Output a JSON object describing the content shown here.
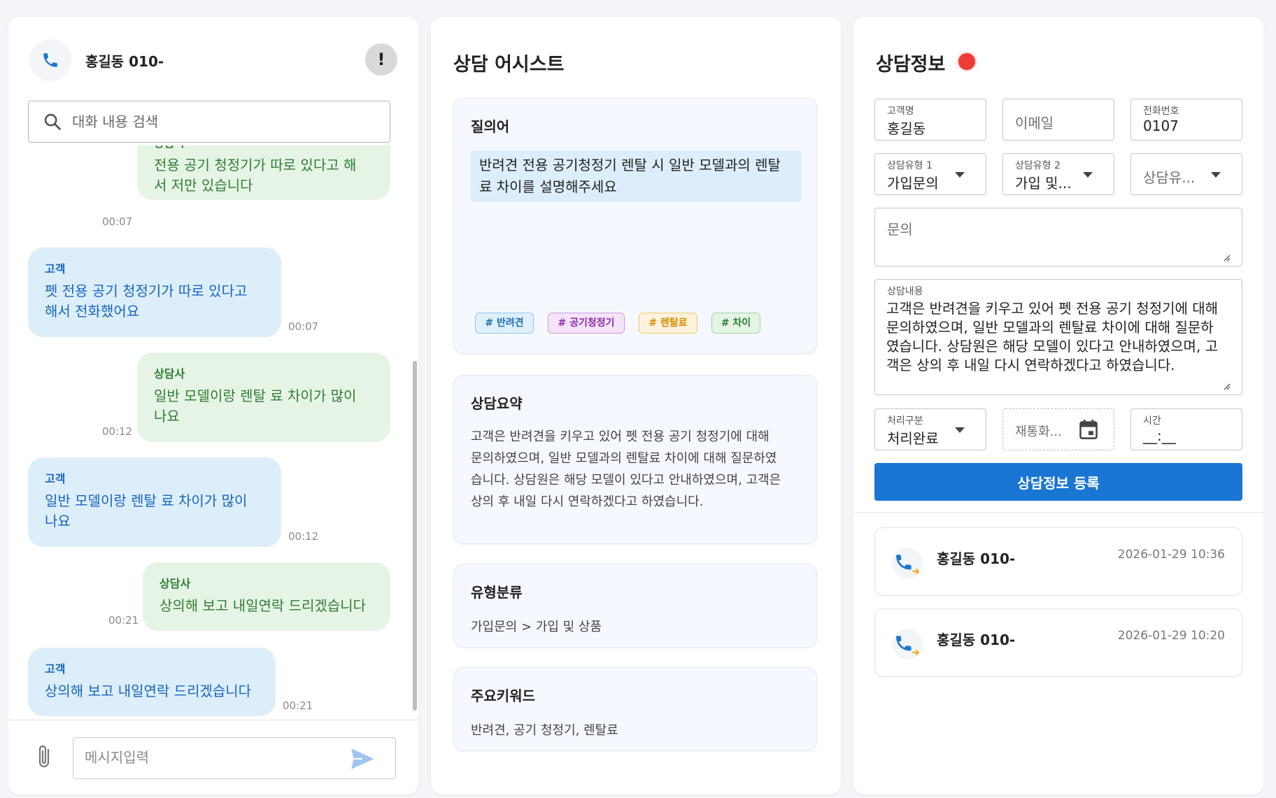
{
  "chat": {
    "header_title": "홍길동 010-",
    "alert_symbol": "!",
    "search_placeholder": "대화 내용 검색",
    "messages": [
      {
        "sender": "상담사",
        "text_lines": [
          "전용 공기 청정기가 따로 있다고 해",
          "서 저만 있습니다"
        ],
        "time": "00:07"
      },
      {
        "sender": "고객",
        "text_lines": [
          "펫 전용 공기 청정기가 따로 있다고",
          "해서 전화했어요"
        ],
        "time": "00:07"
      },
      {
        "sender": "상담사",
        "text_lines": [
          "일반 모델이랑 렌탈 료 차이가 많이",
          "나요"
        ],
        "time": "00:12"
      },
      {
        "sender": "고객",
        "text_lines": [
          "일반 모델이랑 렌탈 료 차이가 많이",
          "나요"
        ],
        "time": "00:12"
      },
      {
        "sender": "상담사",
        "text_lines": [
          "상의해 보고 내일연락 드리겠습니다"
        ],
        "time": "00:21"
      },
      {
        "sender": "고객",
        "text_lines": [
          "상의해 보고 내일연락 드리겠습니다"
        ],
        "time": "00:21"
      }
    ],
    "input_placeholder": "메시지입력"
  },
  "assist": {
    "title": "상담 어시스트",
    "query_card": {
      "title": "질의어",
      "query_lines": [
        "반려견 전용 공기청정기 렌탈 시 일반 모델과의 렌탈",
        "료 차이를 설명해주세요"
      ],
      "tags": [
        "# 반려견",
        "# 공기청정기",
        "# 렌탈료",
        "# 차이"
      ]
    },
    "summary_card": {
      "title": "상담요약",
      "lines": [
        "고객은 반려견을 키우고 있어 펫 전용 공기 청정기에 대해",
        "문의하였으며, 일반 모델과의 렌탈료 차이에 대해 질문하였",
        "습니다. 상담원은 해당 모델이 있다고 안내하였으며, 고객은",
        "상의 후 내일 다시 연락하겠다고 하였습니다."
      ]
    },
    "type_card": {
      "title": "유형분류",
      "text": "가입문의 > 가입 및 상품"
    },
    "keyword_card": {
      "title": "주요키워드",
      "text": "반려견, 공기 청정기, 렌탈료"
    }
  },
  "info": {
    "title": "상담정보",
    "fields": {
      "customer_name": {
        "label": "고객명",
        "value": "홍길동"
      },
      "email": {
        "placeholder": "이메일"
      },
      "phone": {
        "label": "전화번호",
        "value": "0107"
      },
      "type1": {
        "label": "상담유형 1",
        "value": "가입문의"
      },
      "type2": {
        "label": "상담유형 2",
        "value": "가입 및..."
      },
      "type3": {
        "placeholder": "상담유..."
      },
      "inquiry": {
        "placeholder": "문의"
      },
      "content": {
        "label": "상담내용",
        "value": "고객은 반려견을 키우고 있어 펫 전용 공기 청정기에 대해 문의하였으며, 일반 모델과의 렌탈료 차이에 대해 질문하였습니다. 상담원은 해당 모델이 있다고 안내하였으며, 고객은 상의 후 내일 다시 연락하겠다고 하였습니다."
      },
      "status": {
        "label": "처리구분",
        "value": "처리완료"
      },
      "recall_date": {
        "placeholder": "재통화..."
      },
      "time": {
        "label": "시간",
        "value": "__:__"
      }
    },
    "submit_label": "상담정보 등록",
    "history": [
      {
        "name": "홍길동 010-",
        "datetime": "2026-01-29 10:36"
      },
      {
        "name": "홍길동 010-",
        "datetime": "2026-01-29 10:20"
      }
    ]
  },
  "colors": {
    "primary": "#1976d2",
    "agent_bubble": "#e6f4e6",
    "agent_text": "#2e7d32",
    "customer_bubble": "#ddeefb",
    "customer_text": "#1565c0",
    "recording_dot": "#ef3b36",
    "call_arrow": "#f5a623"
  },
  "icons": [
    "phone-icon",
    "alert-icon",
    "search-icon",
    "paperclip-icon",
    "send-icon",
    "calendar-icon",
    "dropdown-caret-icon",
    "incoming-call-icon"
  ]
}
